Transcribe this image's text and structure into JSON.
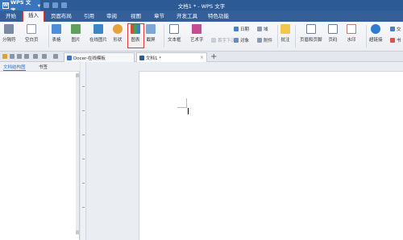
{
  "app": {
    "name": "WPS 文字",
    "title": "文档1 * - WPS 文字"
  },
  "menu": {
    "tabs": [
      {
        "label": "开始"
      },
      {
        "label": "插入"
      },
      {
        "label": "页面布局"
      },
      {
        "label": "引用"
      },
      {
        "label": "审阅"
      },
      {
        "label": "视图"
      },
      {
        "label": "章节"
      },
      {
        "label": "开发工具"
      },
      {
        "label": "特色功能"
      }
    ],
    "active": "插入"
  },
  "ribbon": {
    "fenyefu": "分隔符",
    "kongbaiye": "空白页",
    "biaoge": "表格",
    "tupian": "图片",
    "zaixiantupian": "在线图片",
    "xingzhuang": "形状",
    "tubiao": "图表",
    "jietu": "截屏",
    "wenbenkuang": "文本框",
    "yishuzi": "艺术字",
    "shouzixiachen": "首字下沉",
    "riqi": "日期",
    "duixiang": "对象",
    "yu": "域",
    "fujian": "附件",
    "pizhu": "批注",
    "yemeihe": "页眉和页脚",
    "yema": "页码",
    "shuiyin": "水印",
    "chaolianjie": "超链接",
    "more1": "交",
    "more2": "书"
  },
  "tabs": {
    "docer": "Docer-在线模板",
    "doc1": "文档1 *",
    "close": "×",
    "add": "+"
  },
  "nav": {
    "tab1": "文档结构图",
    "tab2": "书签"
  },
  "colors": {
    "titlebar": "#2b5a95",
    "highlight": "#e03a3a"
  }
}
